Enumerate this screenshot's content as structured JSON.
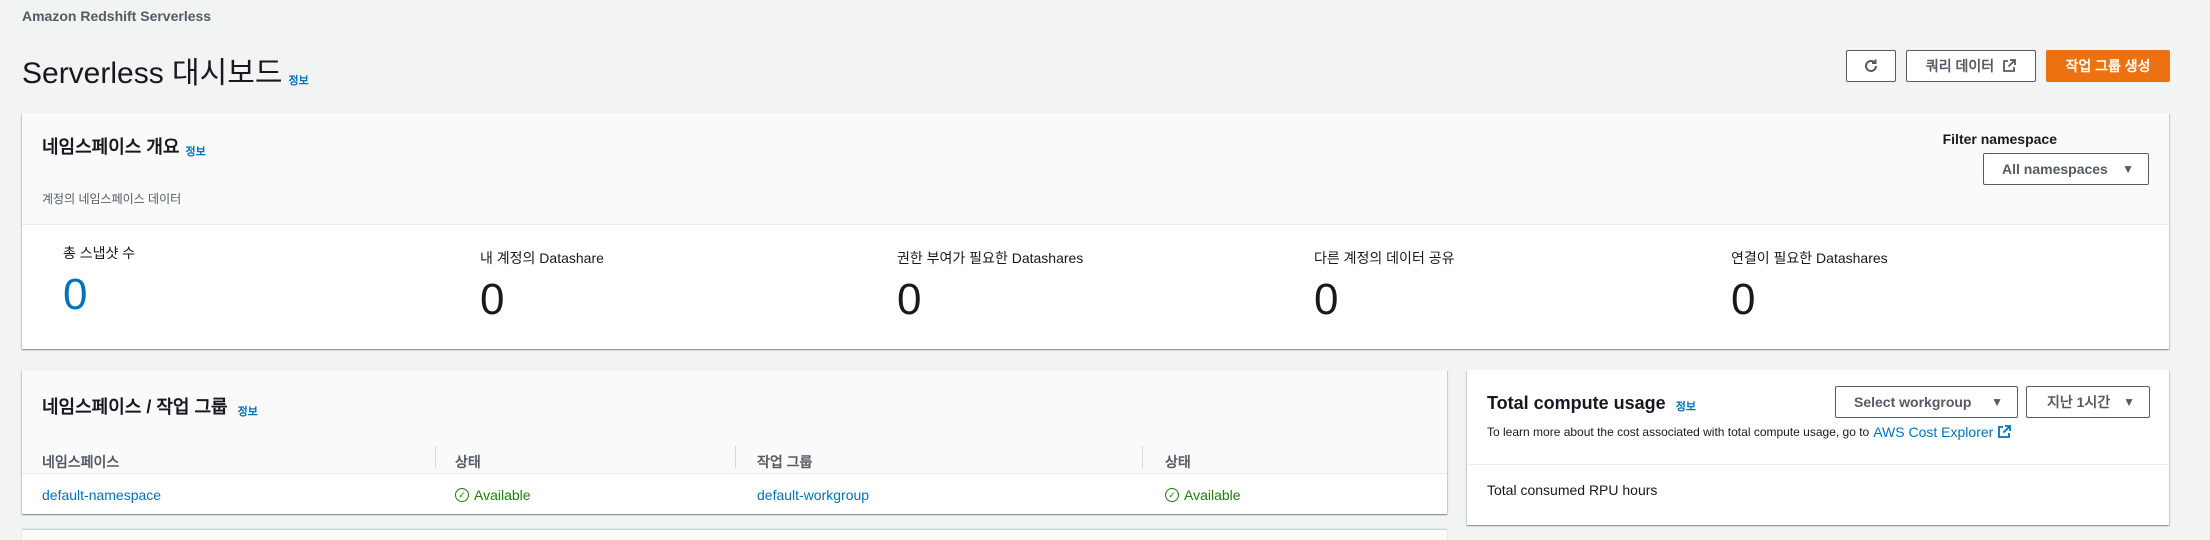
{
  "breadcrumb": "Amazon Redshift Serverless",
  "page": {
    "title": "Serverless 대시보드",
    "info": "정보"
  },
  "actions": {
    "refresh_icon": "refresh-icon",
    "query_label": "쿼리 데이터",
    "create_label": "작업 그룹 생성"
  },
  "overview": {
    "title": "네임스페이스 개요",
    "info": "정보",
    "subtitle": "계정의 네임스페이스 데이터",
    "filter_label": "Filter namespace",
    "filter_value": "All namespaces",
    "stats": [
      {
        "label": "총 스냅샷 수",
        "value": "0"
      },
      {
        "label": "내 계정의 Datashare",
        "value": "0"
      },
      {
        "label": "권한 부여가 필요한 Datashares",
        "value": "0"
      },
      {
        "label": "다른 계정의 데이터 공유",
        "value": "0"
      },
      {
        "label": "연결이 필요한 Datashares",
        "value": "0"
      }
    ]
  },
  "namespaces": {
    "title": "네임스페이스 / 작업 그룹",
    "info": "정보",
    "columns": [
      "네임스페이스",
      "상태",
      "작업 그룹",
      "상태"
    ],
    "rows": [
      {
        "namespace": "default-namespace",
        "ns_status": "Available",
        "workgroup": "default-workgroup",
        "wg_status": "Available"
      }
    ]
  },
  "compute": {
    "title": "Total compute usage",
    "info": "정보",
    "description": "To learn more about the cost associated with total compute usage, go to",
    "link": "AWS Cost Explorer",
    "workgroup_select": "Select workgroup",
    "time_select": "지난 1시간",
    "rpu_label": "Total consumed RPU hours"
  },
  "colors": {
    "accent": "#ec7211",
    "link": "#0073bb",
    "success": "#1d8102"
  }
}
